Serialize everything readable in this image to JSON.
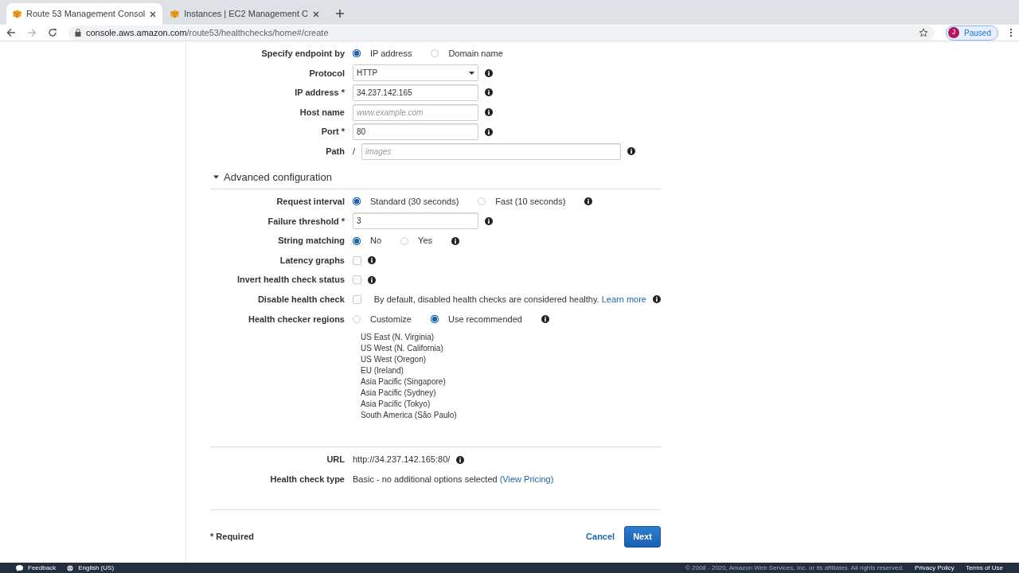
{
  "browser": {
    "tabs": [
      {
        "title": "Route 53 Management Consol",
        "selected": true
      },
      {
        "title": "Instances | EC2 Management C",
        "selected": false
      }
    ],
    "url": {
      "host": "console.aws.amazon.com",
      "path": "/route53/healthchecks/home#/create"
    },
    "profile": {
      "initial": "J",
      "status": "Paused"
    }
  },
  "endpoint_fields": [
    {
      "kind": "radio",
      "label": "Specify endpoint by",
      "info": false,
      "options": [
        {
          "label": "IP address",
          "selected": true
        },
        {
          "label": "Domain name",
          "selected": false
        }
      ]
    },
    {
      "kind": "select",
      "label": "Protocol",
      "value": "HTTP",
      "info": true
    },
    {
      "kind": "text",
      "label": "IP address *",
      "value": "34.237.142.165",
      "info": true
    },
    {
      "kind": "text",
      "label": "Host name",
      "placeholder": "www.example.com",
      "info": true
    },
    {
      "kind": "text",
      "label": "Port *",
      "value": "80",
      "info": true
    },
    {
      "kind": "path",
      "label": "Path",
      "prefix": "/",
      "placeholder": "images",
      "info": true
    }
  ],
  "advanced": {
    "title": "Advanced configuration",
    "expanded": true,
    "fields": [
      {
        "kind": "radio",
        "label": "Request interval",
        "info": true,
        "options": [
          {
            "label": "Standard (30 seconds)",
            "selected": true
          },
          {
            "label": "Fast (10 seconds)",
            "selected": false
          }
        ]
      },
      {
        "kind": "text",
        "label": "Failure threshold *",
        "value": "3",
        "info": true
      },
      {
        "kind": "radio",
        "label": "String matching",
        "info": true,
        "options": [
          {
            "label": "No",
            "selected": true
          },
          {
            "label": "Yes",
            "selected": false
          }
        ]
      },
      {
        "kind": "checkbox",
        "label": "Latency graphs",
        "checked": false,
        "info": true
      },
      {
        "kind": "checkbox",
        "label": "Invert health check status",
        "checked": false,
        "info": true
      },
      {
        "kind": "checkbox",
        "label": "Disable health check",
        "checked": false,
        "note": "By default, disabled health checks are considered healthy.",
        "link": "Learn more",
        "info": true
      },
      {
        "kind": "radio",
        "label": "Health checker regions",
        "info": true,
        "options": [
          {
            "label": "Customize",
            "selected": false
          },
          {
            "label": "Use recommended",
            "selected": true
          }
        ]
      }
    ],
    "regions": [
      "US East (N. Virginia)",
      "US West (N. California)",
      "US West (Oregon)",
      "EU (Ireland)",
      "Asia Pacific (Singapore)",
      "Asia Pacific (Sydney)",
      "Asia Pacific (Tokyo)",
      "South America (São Paulo)"
    ]
  },
  "summary": [
    {
      "label": "URL",
      "value": "http://34.237.142.165:80/",
      "info": true
    },
    {
      "label": "Health check type",
      "value": "Basic - no additional options selected",
      "link": "(View Pricing)",
      "info": false
    }
  ],
  "actions": {
    "required_note": "* Required",
    "cancel": "Cancel",
    "next": "Next"
  },
  "footer": {
    "feedback": "Feedback",
    "language": "English (US)",
    "copyright": "© 2008 - 2020, Amazon Web Services, Inc. or its affiliates. All rights reserved.",
    "links": [
      "Privacy Policy",
      "Terms of Use"
    ]
  }
}
